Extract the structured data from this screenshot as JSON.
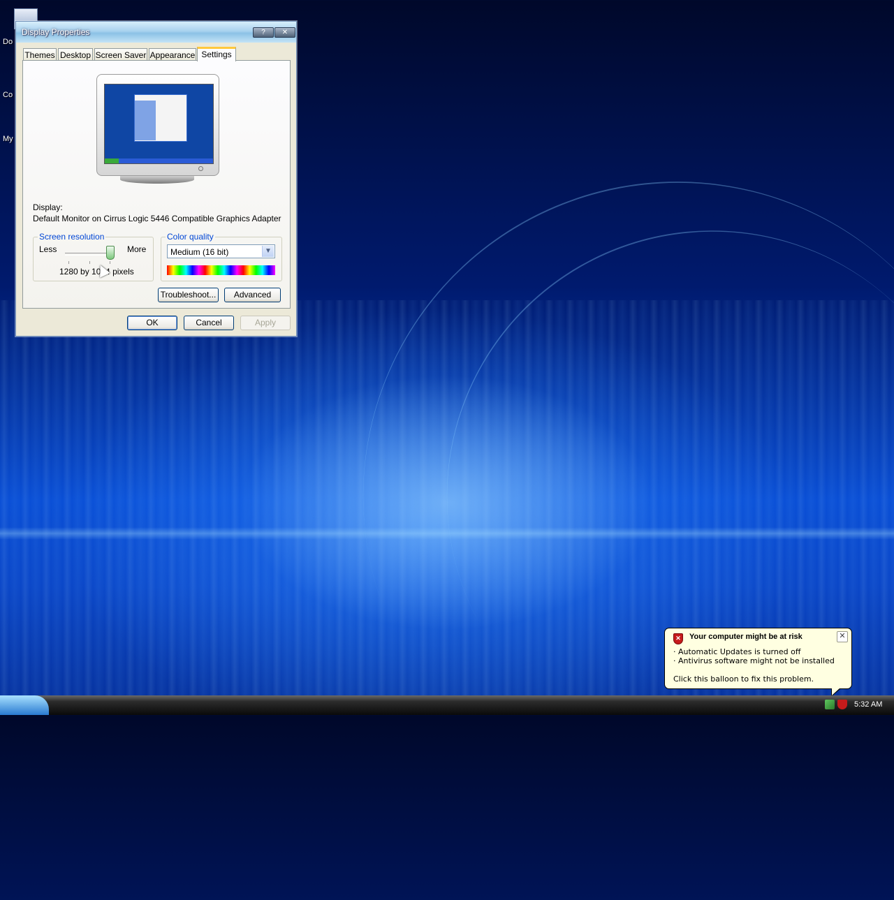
{
  "window": {
    "title": "Display Properties",
    "help_btn": "?",
    "close_btn": "✕",
    "tabs": [
      "Themes",
      "Desktop",
      "Screen Saver",
      "Appearance",
      "Settings"
    ],
    "active_tab": "Settings",
    "display_label": "Display:",
    "display_value": "Default Monitor on Cirrus Logic 5446 Compatible Graphics Adapter",
    "resolution": {
      "title": "Screen resolution",
      "less": "Less",
      "more": "More",
      "value_text": "1280 by 1024 pixels"
    },
    "color_quality": {
      "title": "Color quality",
      "selected": "Medium (16 bit)"
    },
    "troubleshoot_btn": "Troubleshoot...",
    "advanced_btn": "Advanced",
    "ok_btn": "OK",
    "cancel_btn": "Cancel",
    "apply_btn": "Apply"
  },
  "desktop_labels": [
    "Do",
    "Co",
    "My"
  ],
  "balloon": {
    "title": "Your computer might be at risk",
    "line1": "· Automatic Updates is turned off",
    "line2": "· Antivirus software might not be installed",
    "line3": "Click this balloon to fix this problem.",
    "close": "✕"
  },
  "taskbar": {
    "clock": "5:32 AM"
  }
}
